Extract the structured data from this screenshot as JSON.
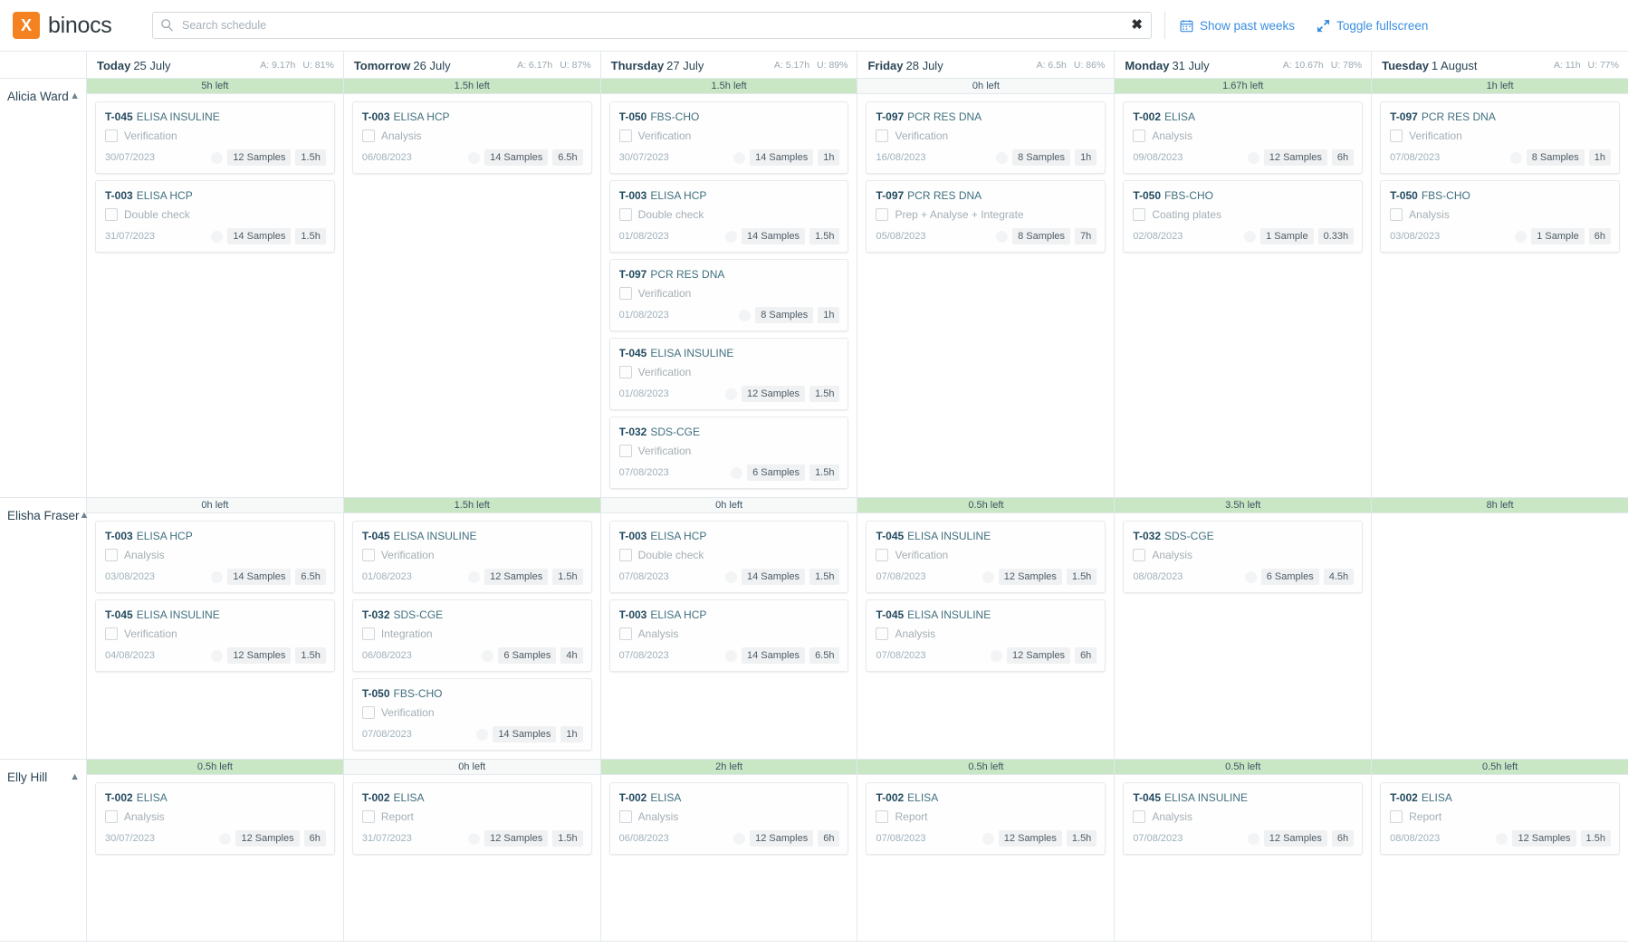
{
  "app": {
    "brand_mark": "X",
    "brand_name": "binocs"
  },
  "search": {
    "placeholder": "Search schedule",
    "value": "",
    "clear_glyph": "✖",
    "icon": "search-icon"
  },
  "top_actions": [
    {
      "label": "Show past weeks",
      "icon": "calendar-icon"
    },
    {
      "label": "Toggle fullscreen",
      "icon": "fullscreen-icon"
    }
  ],
  "days": [
    {
      "name": "Today",
      "date": "25 July",
      "available": "A: 9.17h",
      "utilization": "U: 81%"
    },
    {
      "name": "Tomorrow",
      "date": "26 July",
      "available": "A: 6.17h",
      "utilization": "U: 87%"
    },
    {
      "name": "Thursday",
      "date": "27 July",
      "available": "A: 5.17h",
      "utilization": "U: 89%"
    },
    {
      "name": "Friday",
      "date": "28 July",
      "available": "A: 6.5h",
      "utilization": "U: 86%"
    },
    {
      "name": "Monday",
      "date": "31 July",
      "available": "A: 10.67h",
      "utilization": "U: 78%"
    },
    {
      "name": "Tuesday",
      "date": "1 August",
      "available": "A: 11h",
      "utilization": "U: 77%"
    }
  ],
  "resources": [
    {
      "name": "Alicia Ward",
      "collapse_icon": "chevron-up-icon",
      "columns": [
        {
          "capacity": "5h left",
          "has_capacity": true,
          "cards": [
            {
              "code": "T-045",
              "product": "ELISA INSULINE",
              "step": "Verification",
              "date": "30/07/2023",
              "samples": "12 Samples",
              "duration": "1.5h"
            },
            {
              "code": "T-003",
              "product": "ELISA HCP",
              "step": "Double check",
              "date": "31/07/2023",
              "samples": "14 Samples",
              "duration": "1.5h"
            }
          ]
        },
        {
          "capacity": "1.5h left",
          "has_capacity": true,
          "cards": [
            {
              "code": "T-003",
              "product": "ELISA HCP",
              "step": "Analysis",
              "date": "06/08/2023",
              "samples": "14 Samples",
              "duration": "6.5h"
            }
          ]
        },
        {
          "capacity": "1.5h left",
          "has_capacity": true,
          "cards": [
            {
              "code": "T-050",
              "product": "FBS-CHO",
              "step": "Verification",
              "date": "30/07/2023",
              "samples": "14 Samples",
              "duration": "1h"
            },
            {
              "code": "T-003",
              "product": "ELISA HCP",
              "step": "Double check",
              "date": "01/08/2023",
              "samples": "14 Samples",
              "duration": "1.5h"
            },
            {
              "code": "T-097",
              "product": "PCR RES DNA",
              "step": "Verification",
              "date": "01/08/2023",
              "samples": "8 Samples",
              "duration": "1h"
            },
            {
              "code": "T-045",
              "product": "ELISA INSULINE",
              "step": "Verification",
              "date": "01/08/2023",
              "samples": "12 Samples",
              "duration": "1.5h"
            },
            {
              "code": "T-032",
              "product": "SDS-CGE",
              "step": "Verification",
              "date": "07/08/2023",
              "samples": "6 Samples",
              "duration": "1.5h"
            }
          ]
        },
        {
          "capacity": "0h left",
          "has_capacity": false,
          "cards": [
            {
              "code": "T-097",
              "product": "PCR RES DNA",
              "step": "Verification",
              "date": "16/08/2023",
              "samples": "8 Samples",
              "duration": "1h"
            },
            {
              "code": "T-097",
              "product": "PCR RES DNA",
              "step": "Prep + Analyse + Integrate",
              "date": "05/08/2023",
              "samples": "8 Samples",
              "duration": "7h"
            }
          ]
        },
        {
          "capacity": "1.67h left",
          "has_capacity": true,
          "cards": [
            {
              "code": "T-002",
              "product": "ELISA",
              "step": "Analysis",
              "date": "09/08/2023",
              "samples": "12 Samples",
              "duration": "6h"
            },
            {
              "code": "T-050",
              "product": "FBS-CHO",
              "step": "Coating plates",
              "date": "02/08/2023",
              "samples": "1 Sample",
              "duration": "0.33h"
            }
          ]
        },
        {
          "capacity": "1h left",
          "has_capacity": true,
          "cards": [
            {
              "code": "T-097",
              "product": "PCR RES DNA",
              "step": "Verification",
              "date": "07/08/2023",
              "samples": "8 Samples",
              "duration": "1h"
            },
            {
              "code": "T-050",
              "product": "FBS-CHO",
              "step": "Analysis",
              "date": "03/08/2023",
              "samples": "1 Sample",
              "duration": "6h"
            }
          ]
        }
      ]
    },
    {
      "name": "Elisha Fraser",
      "collapse_icon": "chevron-up-icon",
      "columns": [
        {
          "capacity": "0h left",
          "has_capacity": false,
          "cards": [
            {
              "code": "T-003",
              "product": "ELISA HCP",
              "step": "Analysis",
              "date": "03/08/2023",
              "samples": "14 Samples",
              "duration": "6.5h"
            },
            {
              "code": "T-045",
              "product": "ELISA INSULINE",
              "step": "Verification",
              "date": "04/08/2023",
              "samples": "12 Samples",
              "duration": "1.5h"
            }
          ]
        },
        {
          "capacity": "1.5h left",
          "has_capacity": true,
          "cards": [
            {
              "code": "T-045",
              "product": "ELISA INSULINE",
              "step": "Verification",
              "date": "01/08/2023",
              "samples": "12 Samples",
              "duration": "1.5h"
            },
            {
              "code": "T-032",
              "product": "SDS-CGE",
              "step": "Integration",
              "date": "06/08/2023",
              "samples": "6 Samples",
              "duration": "4h"
            },
            {
              "code": "T-050",
              "product": "FBS-CHO",
              "step": "Verification",
              "date": "07/08/2023",
              "samples": "14 Samples",
              "duration": "1h"
            }
          ]
        },
        {
          "capacity": "0h left",
          "has_capacity": false,
          "cards": [
            {
              "code": "T-003",
              "product": "ELISA HCP",
              "step": "Double check",
              "date": "07/08/2023",
              "samples": "14 Samples",
              "duration": "1.5h"
            },
            {
              "code": "T-003",
              "product": "ELISA HCP",
              "step": "Analysis",
              "date": "07/08/2023",
              "samples": "14 Samples",
              "duration": "6.5h"
            }
          ]
        },
        {
          "capacity": "0.5h left",
          "has_capacity": true,
          "cards": [
            {
              "code": "T-045",
              "product": "ELISA INSULINE",
              "step": "Verification",
              "date": "07/08/2023",
              "samples": "12 Samples",
              "duration": "1.5h"
            },
            {
              "code": "T-045",
              "product": "ELISA INSULINE",
              "step": "Analysis",
              "date": "07/08/2023",
              "samples": "12 Samples",
              "duration": "6h"
            }
          ]
        },
        {
          "capacity": "3.5h left",
          "has_capacity": true,
          "cards": [
            {
              "code": "T-032",
              "product": "SDS-CGE",
              "step": "Analysis",
              "date": "08/08/2023",
              "samples": "6 Samples",
              "duration": "4.5h"
            }
          ]
        },
        {
          "capacity": "8h left",
          "has_capacity": true,
          "cards": []
        }
      ]
    },
    {
      "name": "Elly Hill",
      "collapse_icon": "chevron-up-icon",
      "columns": [
        {
          "capacity": "0.5h left",
          "has_capacity": true,
          "cards": [
            {
              "code": "T-002",
              "product": "ELISA",
              "step": "Analysis",
              "date": "30/07/2023",
              "samples": "12 Samples",
              "duration": "6h"
            }
          ]
        },
        {
          "capacity": "0h left",
          "has_capacity": false,
          "cards": [
            {
              "code": "T-002",
              "product": "ELISA",
              "step": "Report",
              "date": "31/07/2023",
              "samples": "12 Samples",
              "duration": "1.5h"
            }
          ]
        },
        {
          "capacity": "2h left",
          "has_capacity": true,
          "cards": [
            {
              "code": "T-002",
              "product": "ELISA",
              "step": "Analysis",
              "date": "06/08/2023",
              "samples": "12 Samples",
              "duration": "6h"
            }
          ]
        },
        {
          "capacity": "0.5h left",
          "has_capacity": true,
          "cards": [
            {
              "code": "T-002",
              "product": "ELISA",
              "step": "Report",
              "date": "07/08/2023",
              "samples": "12 Samples",
              "duration": "1.5h"
            }
          ]
        },
        {
          "capacity": "0.5h left",
          "has_capacity": true,
          "cards": [
            {
              "code": "T-045",
              "product": "ELISA INSULINE",
              "step": "Analysis",
              "date": "07/08/2023",
              "samples": "12 Samples",
              "duration": "6h"
            }
          ]
        },
        {
          "capacity": "0.5h left",
          "has_capacity": true,
          "cards": [
            {
              "code": "T-002",
              "product": "ELISA",
              "step": "Report",
              "date": "08/08/2023",
              "samples": "12 Samples",
              "duration": "1.5h"
            }
          ]
        }
      ]
    }
  ],
  "colors": {
    "brand_orange": "#f58220",
    "link_blue": "#3b8fe0",
    "capacity_green": "#c9e7c4",
    "title_navy": "#234b60"
  }
}
